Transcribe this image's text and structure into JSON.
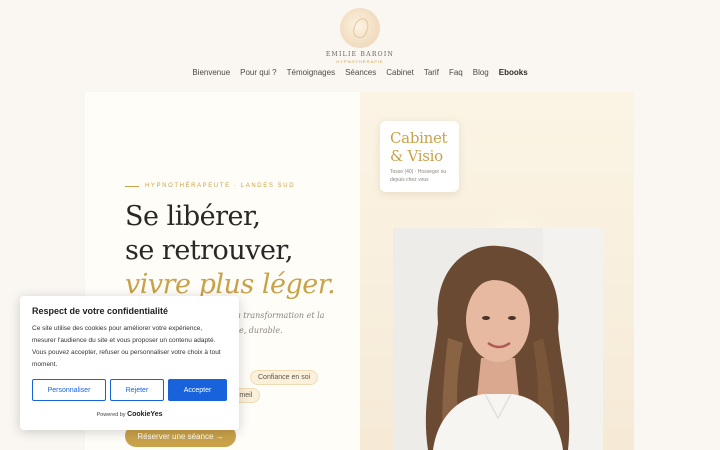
{
  "logo": {
    "name": "EMILIE BAROIN",
    "subtitle": "HYPNOTHÉRAPIE"
  },
  "nav": [
    "Bienvenue",
    "Pour qui ?",
    "Témoignages",
    "Séances",
    "Cabinet",
    "Tarif",
    "Faq",
    "Blog",
    "Ebooks"
  ],
  "hero": {
    "eyebrow": "HYPNOTHÉRAPEUTE · LANDES SUD",
    "title_line1": "Se libérer,",
    "title_line2": "se retrouver,",
    "title_line3": "vivre plus léger.",
    "intro": "Un accompagnement vers la transformation et la bienveillance, à votre rythme, durable.",
    "tags": [
      "Confiance en soi",
      "Sommeil"
    ],
    "cta": "Réserver une séance →"
  },
  "card": {
    "title1": "Cabinet",
    "title2": "& Visio",
    "subtitle": "Tosse (40) · Hossegor ou depuis chez vous"
  },
  "cookie": {
    "title": "Respect de votre confidentialité",
    "text": "Ce site utilise des cookies pour améliorer votre expérience, mesurer l'audience du site et vous proposer un contenu adapté. Vous pouvez accepter, refuser ou personnaliser votre choix à tout moment.",
    "customize": "Personnaliser",
    "reject": "Rejeter",
    "accept": "Accepter",
    "powered_by": "Powered by",
    "brand": "CookieYes"
  },
  "colors": {
    "accent": "#c9a24a",
    "cookie_blue": "#1863dc",
    "background": "#faf7f2"
  }
}
